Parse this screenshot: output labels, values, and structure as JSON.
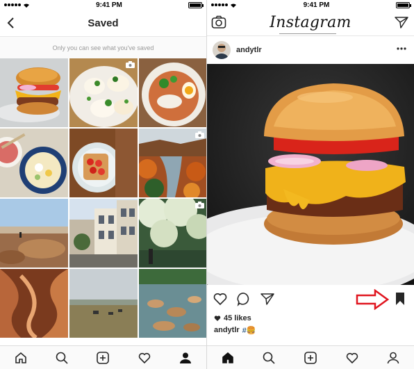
{
  "status_bar": {
    "time": "9:41 PM"
  },
  "saved_screen": {
    "title": "Saved",
    "note": "Only you can see what you've saved",
    "tiles": [
      {
        "name": "saved-post-burger",
        "video": false
      },
      {
        "name": "saved-post-eggs-benedict",
        "video": true
      },
      {
        "name": "saved-post-egg-bowl",
        "video": false
      },
      {
        "name": "saved-post-ramen",
        "video": false
      },
      {
        "name": "saved-post-strawberry-toast",
        "video": false
      },
      {
        "name": "saved-post-autumn-forest",
        "video": true
      },
      {
        "name": "saved-post-desert-hiker",
        "video": false
      },
      {
        "name": "saved-post-victorian-houses",
        "video": false
      },
      {
        "name": "saved-post-blossom-tree",
        "video": true
      },
      {
        "name": "saved-post-slot-canyon",
        "video": false
      },
      {
        "name": "saved-post-cows-field",
        "video": false
      },
      {
        "name": "saved-post-lake-rocks",
        "video": false
      }
    ]
  },
  "feed_screen": {
    "logo": "Instagram",
    "post": {
      "username": "andytlr",
      "likes": "45 likes",
      "caption_user": "andytlr",
      "caption_text": "#🍔"
    }
  },
  "icons": {
    "back": "chevron-left-icon",
    "camera": "camera-icon",
    "direct": "paper-plane-icon",
    "more": "ellipsis-icon",
    "like": "heart-icon",
    "comment": "comment-icon",
    "share": "paper-plane-icon",
    "save": "bookmark-icon",
    "annotation": "red-arrow-icon",
    "nav": [
      "home-icon",
      "search-icon",
      "add-post-icon",
      "activity-heart-icon",
      "profile-icon"
    ]
  },
  "colors": {
    "annotation_red": "#e0141e",
    "text": "#262626",
    "muted": "#999999"
  }
}
